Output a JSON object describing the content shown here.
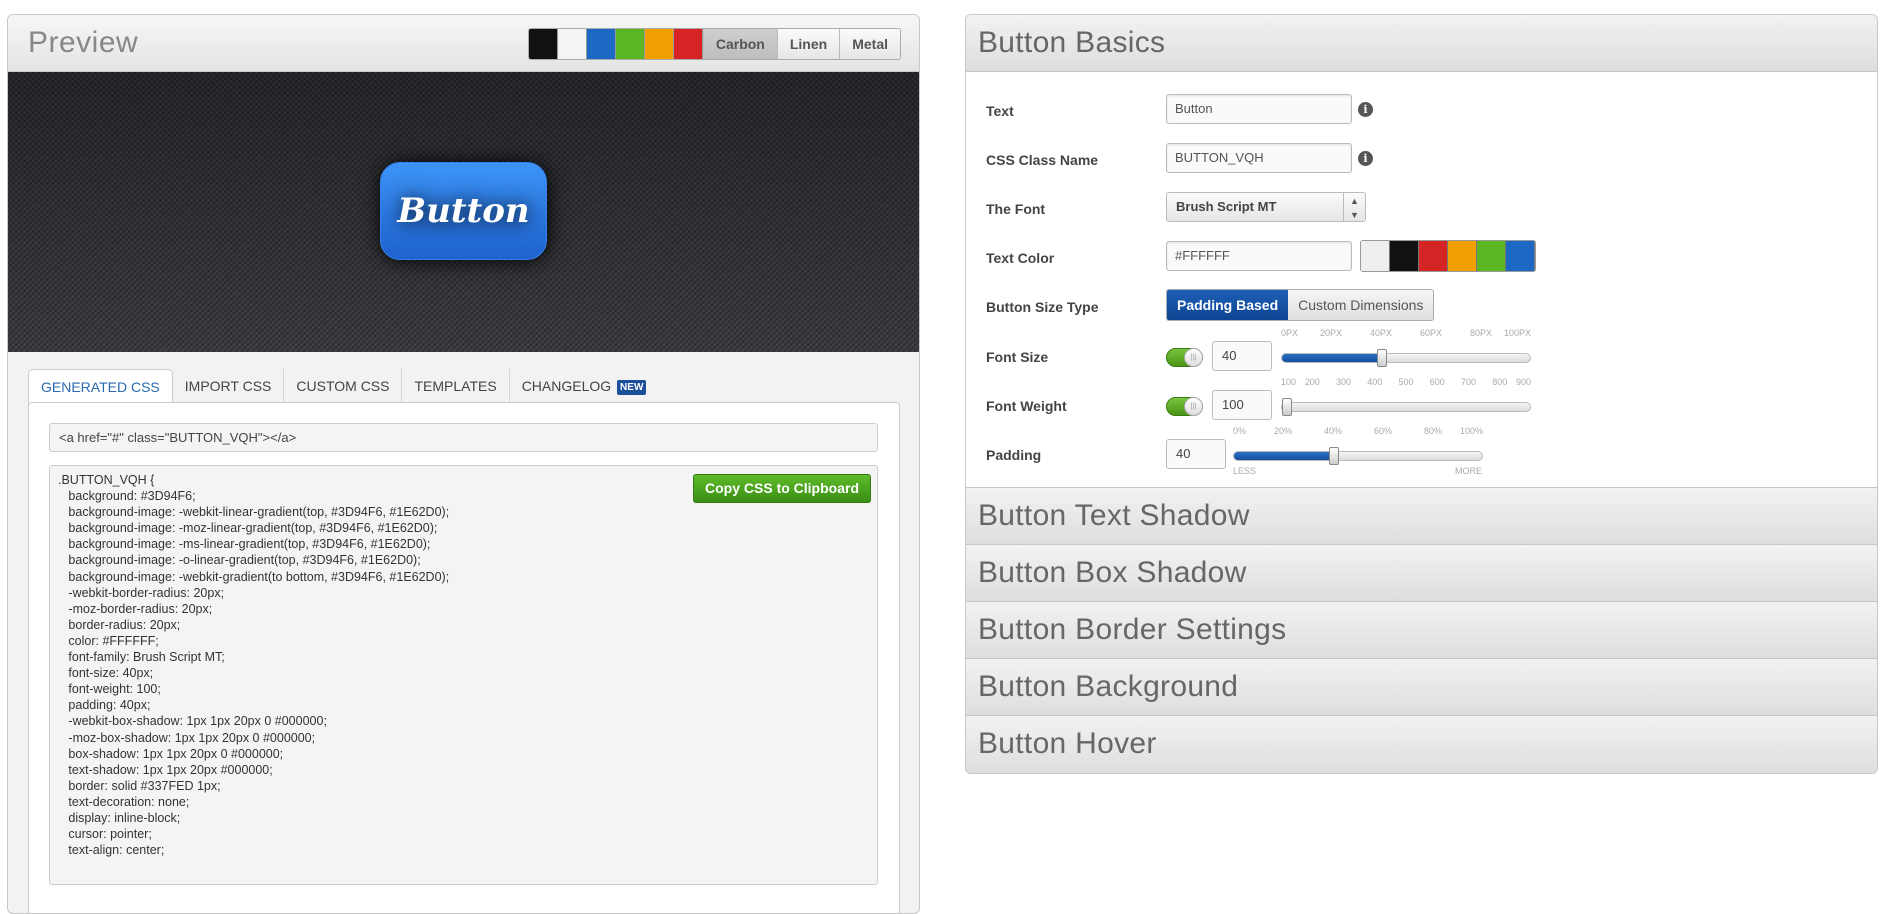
{
  "preview": {
    "title": "Preview",
    "swatches": [
      "#111111",
      "#f4f4f4",
      "#1c68c4",
      "#5cb624",
      "#f0a000",
      "#d62424"
    ],
    "bg_options": [
      {
        "label": "Carbon",
        "active": true
      },
      {
        "label": "Linen",
        "active": false
      },
      {
        "label": "Metal",
        "active": false
      }
    ],
    "demo_button_text": "Button"
  },
  "tabs": [
    {
      "label": "GENERATED CSS",
      "active": true
    },
    {
      "label": "IMPORT CSS",
      "active": false
    },
    {
      "label": "CUSTOM CSS",
      "active": false
    },
    {
      "label": "TEMPLATES",
      "active": false
    },
    {
      "label": "CHANGELOG",
      "badge": "NEW",
      "active": false
    }
  ],
  "html_snippet": "<a href=\"#\" class=\"BUTTON_VQH\"></a>",
  "copy_button": "Copy CSS to Clipboard",
  "css_lines": [
    ".BUTTON_VQH {",
    "   background: #3D94F6;",
    "   background-image: -webkit-linear-gradient(top, #3D94F6, #1E62D0);",
    "   background-image: -moz-linear-gradient(top, #3D94F6, #1E62D0);",
    "   background-image: -ms-linear-gradient(top, #3D94F6, #1E62D0);",
    "   background-image: -o-linear-gradient(top, #3D94F6, #1E62D0);",
    "   background-image: -webkit-gradient(to bottom, #3D94F6, #1E62D0);",
    "   -webkit-border-radius: 20px;",
    "   -moz-border-radius: 20px;",
    "   border-radius: 20px;",
    "   color: #FFFFFF;",
    "   font-family: Brush Script MT;",
    "   font-size: 40px;",
    "   font-weight: 100;",
    "   padding: 40px;",
    "   -webkit-box-shadow: 1px 1px 20px 0 #000000;",
    "   -moz-box-shadow: 1px 1px 20px 0 #000000;",
    "   box-shadow: 1px 1px 20px 0 #000000;",
    "   text-shadow: 1px 1px 20px #000000;",
    "   border: solid #337FED 1px;",
    "   text-decoration: none;",
    "   display: inline-block;",
    "   cursor: pointer;",
    "   text-align: center;"
  ],
  "basics": {
    "title": "Button Basics",
    "text_label": "Text",
    "text_value": "Button",
    "class_label": "CSS Class Name",
    "class_value": "BUTTON_VQH",
    "font_label": "The Font",
    "font_value": "Brush Script MT",
    "color_label": "Text Color",
    "color_value": "#FFFFFF",
    "color_swatches": [
      "#eeeeee",
      "#111111",
      "#d42424",
      "#f0a000",
      "#5cb624",
      "#1c68c4"
    ],
    "size_type_label": "Button Size Type",
    "size_types": [
      {
        "label": "Padding Based",
        "active": true
      },
      {
        "label": "Custom Dimensions",
        "active": false
      }
    ],
    "font_size_label": "Font Size",
    "font_size_value": "40",
    "font_size_ticks": [
      "0PX",
      "20PX",
      "40PX",
      "60PX",
      "80PX",
      "100PX"
    ],
    "font_size_fraction": 0.4,
    "font_weight_label": "Font Weight",
    "font_weight_value": "100",
    "font_weight_ticks": [
      "100",
      "200",
      "300",
      "400",
      "500",
      "600",
      "700",
      "800",
      "900"
    ],
    "font_weight_fraction": 0.0,
    "padding_label": "Padding",
    "padding_value": "40",
    "padding_ticks": [
      "0%",
      "20%",
      "40%",
      "60%",
      "80%",
      "100%"
    ],
    "padding_fraction": 0.4,
    "padding_less": "LESS",
    "padding_more": "MORE"
  },
  "sections": [
    "Button Text Shadow",
    "Button Box Shadow",
    "Button Border Settings",
    "Button Background",
    "Button Hover"
  ]
}
